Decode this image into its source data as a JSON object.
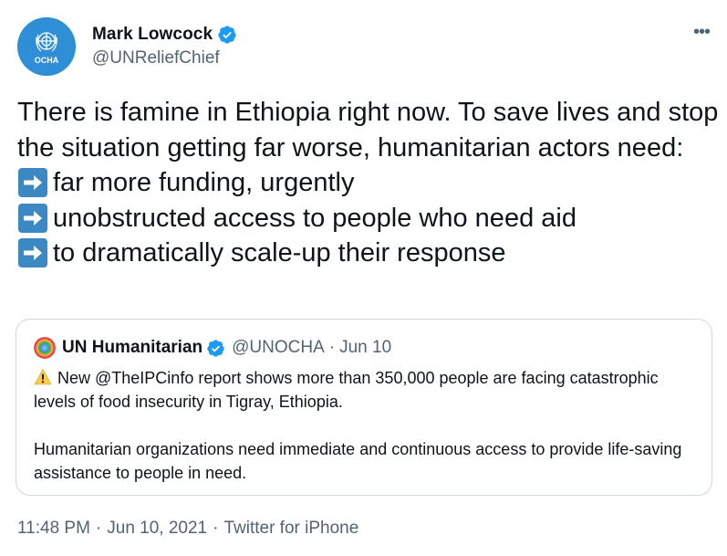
{
  "author": {
    "display_name": "Mark Lowcock",
    "handle": "@UNReliefChief",
    "avatar_label": "OCHA",
    "verified": true
  },
  "tweet": {
    "intro": "There is famine in Ethiopia right now. To save lives and stop the situation getting far worse, humanitarian actors need:",
    "points": [
      "far more funding, urgently",
      "unobstructed access to people who need aid",
      "to dramatically scale-up their response"
    ]
  },
  "quoted_tweet": {
    "display_name": "UN Humanitarian",
    "handle": "@UNOCHA",
    "separator": "·",
    "date": "Jun 10",
    "paragraph_1": "New @TheIPCinfo report shows more than 350,000 people are facing catastrophic levels of food insecurity in Tigray, Ethiopia.",
    "paragraph_2": "Humanitarian organizations need immediate and continuous access to provide life-saving assistance to people in need."
  },
  "meta": {
    "time": "11:48 PM",
    "date": "Jun 10, 2021",
    "source": "Twitter for iPhone",
    "separator": "·"
  },
  "icons": {
    "more": "more-options-icon",
    "verified": "verified-badge-icon",
    "arrow": "right-arrow-emoji-icon",
    "warning": "warning-emoji-icon"
  },
  "colors": {
    "verified_blue": "#1d9bf0",
    "avatar_blue": "#2f8fd6",
    "secondary_text": "#536471",
    "border": "#cfd9de",
    "arrow_emoji_bg": "#3b88c3"
  }
}
